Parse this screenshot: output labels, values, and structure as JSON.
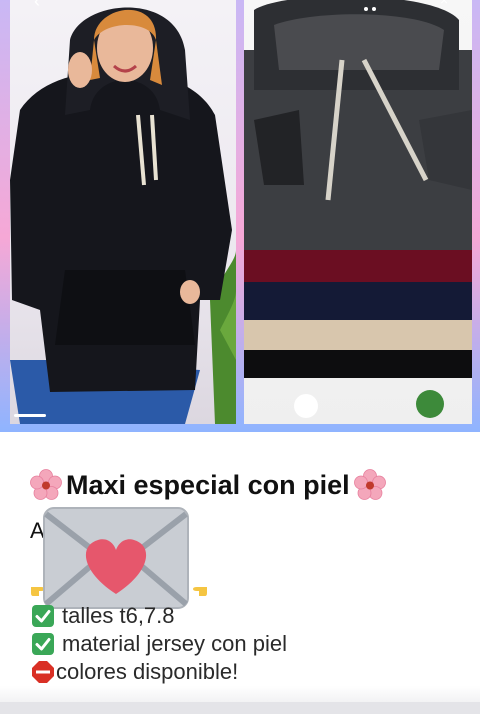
{
  "post": {
    "title": "Maxi especial con piel",
    "intro": "A",
    "items": [
      {
        "icon": "check-box-icon",
        "text": "talles t6,7.8"
      },
      {
        "icon": "check-box-icon",
        "text": "material jersey con piel"
      },
      {
        "icon": "stop-sign-icon",
        "text": "colores disponible!"
      }
    ]
  },
  "icons": {
    "title_decoration": "cherry-blossom-icon",
    "sticker": "love-letter-icon",
    "pointing": "backhand-index-pointing-right-icon"
  },
  "colors": {
    "blossom": "#f4a7bb",
    "check": "#3aa757",
    "stop": "#d93025",
    "letter_heart": "#e6576c",
    "gradient_top": "#c9b8f5",
    "gradient_mid": "#f6a8d6",
    "gradient_bottom": "#8fb4ff"
  }
}
